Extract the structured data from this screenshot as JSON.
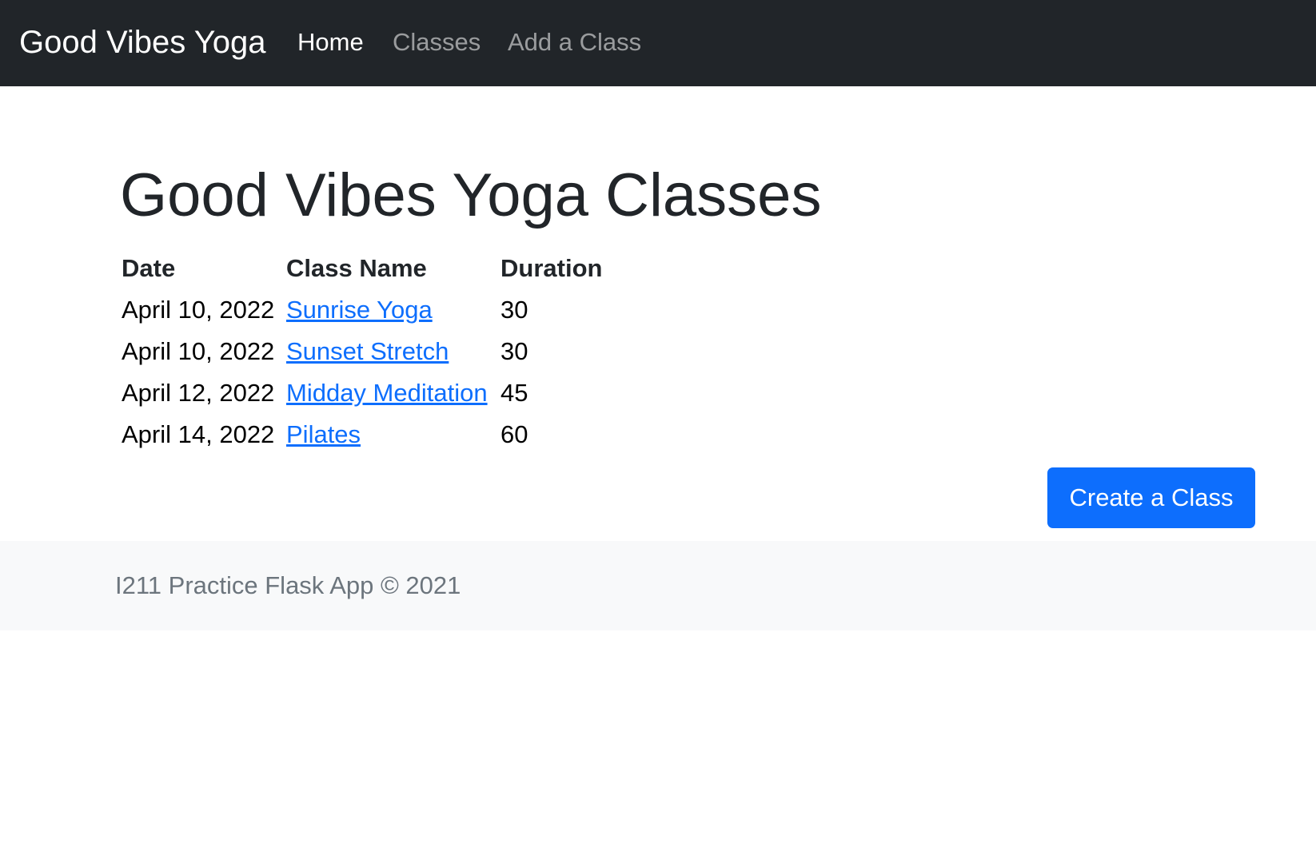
{
  "navbar": {
    "brand": "Good Vibes Yoga",
    "links": [
      {
        "label": "Home",
        "active": true
      },
      {
        "label": "Classes",
        "active": false
      },
      {
        "label": "Add a Class",
        "active": false
      }
    ]
  },
  "main": {
    "title": "Good Vibes Yoga Classes",
    "table": {
      "headers": [
        "Date",
        "Class Name",
        "Duration"
      ],
      "rows": [
        {
          "date": "April 10, 2022",
          "name": "Sunrise Yoga",
          "duration": "30"
        },
        {
          "date": "April 10, 2022",
          "name": "Sunset Stretch",
          "duration": "30"
        },
        {
          "date": "April 12, 2022",
          "name": "Midday Meditation",
          "duration": "45"
        },
        {
          "date": "April 14, 2022",
          "name": "Pilates",
          "duration": "60"
        }
      ]
    },
    "create_button_label": "Create a Class"
  },
  "footer": {
    "text": "I211 Practice Flask App © 2021"
  },
  "colors": {
    "navbar_bg": "#212529",
    "link": "#0d6efd",
    "primary_button": "#0d6efd",
    "footer_bg": "#f8f9fa",
    "footer_text": "#6c757d"
  }
}
